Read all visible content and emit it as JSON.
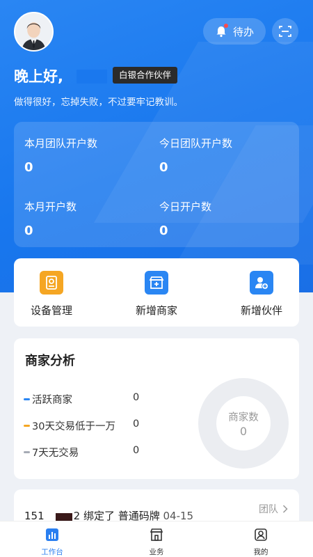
{
  "header": {
    "todo_label": "待办",
    "greeting": "晚上好,",
    "role_badge": "白银合作伙伴",
    "motto": "做得很好，忘掉失败，不过要牢记教训。"
  },
  "stats": [
    {
      "label": "本月团队开户数",
      "value": "0"
    },
    {
      "label": "今日团队开户数",
      "value": "0"
    },
    {
      "label": "本月开户数",
      "value": "0"
    },
    {
      "label": "今日开户数",
      "value": "0"
    }
  ],
  "actions": [
    {
      "label": "设备管理",
      "icon": "device-icon",
      "color": "#f5a623"
    },
    {
      "label": "新增商家",
      "icon": "shop-add-icon",
      "color": "#2a86f3"
    },
    {
      "label": "新增伙伴",
      "icon": "partner-add-icon",
      "color": "#2a86f3"
    }
  ],
  "analysis": {
    "title": "商家分析",
    "rows": [
      {
        "label": "活跃商家",
        "value": "0",
        "color": "#2a86f3"
      },
      {
        "label": "30天交易低于一万",
        "value": "0",
        "color": "#f5a623"
      },
      {
        "label": "7天无交易",
        "value": "0",
        "color": "#a6abb5"
      }
    ],
    "donut_label": "商家数",
    "donut_value": "0"
  },
  "notice": {
    "prefix": "151",
    "suffix": "2 绑定了 普通码牌",
    "date": "04-15",
    "link": "团队"
  },
  "tabs": [
    {
      "label": "工作台",
      "active": true
    },
    {
      "label": "业务",
      "active": false
    },
    {
      "label": "我的",
      "active": false
    }
  ],
  "colors": {
    "primary": "#1877ee",
    "accent_orange": "#f5a623"
  }
}
